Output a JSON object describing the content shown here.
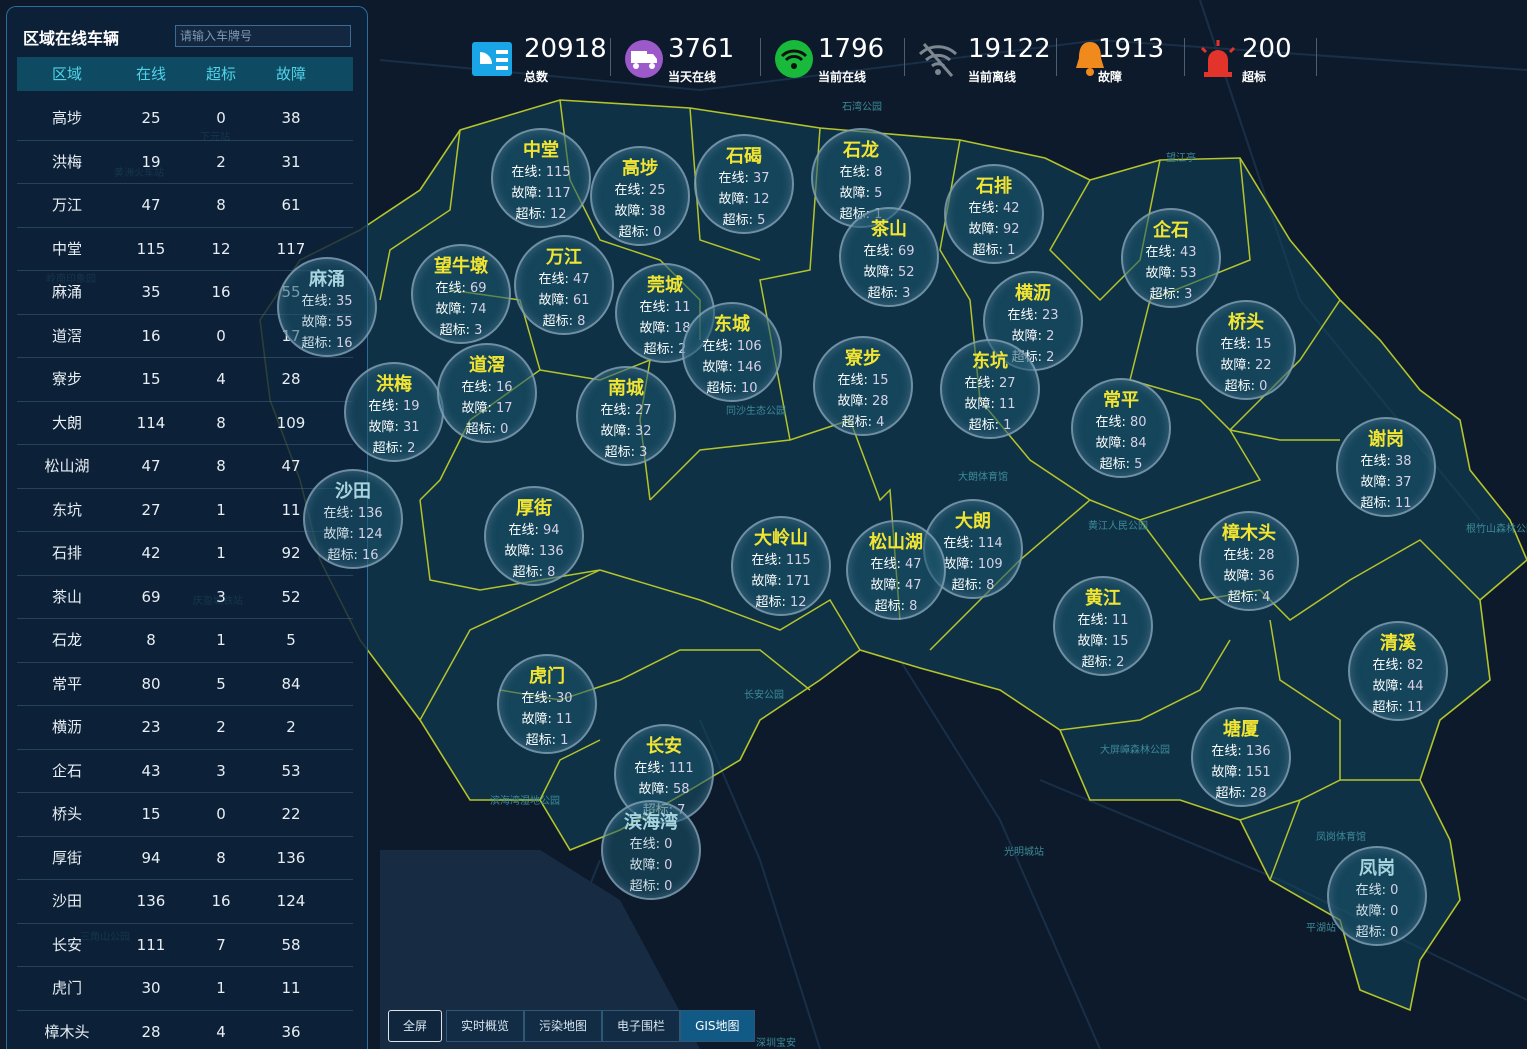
{
  "panel": {
    "title": "区域在线车辆",
    "search_placeholder": "请输入车牌号",
    "headers": [
      "区域",
      "在线",
      "超标",
      "故障"
    ],
    "rows": [
      [
        "高埗",
        "25",
        "0",
        "38"
      ],
      [
        "洪梅",
        "19",
        "2",
        "31"
      ],
      [
        "万江",
        "47",
        "8",
        "61"
      ],
      [
        "中堂",
        "115",
        "12",
        "117"
      ],
      [
        "麻涌",
        "35",
        "16",
        "55"
      ],
      [
        "道滘",
        "16",
        "0",
        "17"
      ],
      [
        "寮步",
        "15",
        "4",
        "28"
      ],
      [
        "大朗",
        "114",
        "8",
        "109"
      ],
      [
        "松山湖",
        "47",
        "8",
        "47"
      ],
      [
        "东坑",
        "27",
        "1",
        "11"
      ],
      [
        "石排",
        "42",
        "1",
        "92"
      ],
      [
        "茶山",
        "69",
        "3",
        "52"
      ],
      [
        "石龙",
        "8",
        "1",
        "5"
      ],
      [
        "常平",
        "80",
        "5",
        "84"
      ],
      [
        "横沥",
        "23",
        "2",
        "2"
      ],
      [
        "企石",
        "43",
        "3",
        "53"
      ],
      [
        "桥头",
        "15",
        "0",
        "22"
      ],
      [
        "厚街",
        "94",
        "8",
        "136"
      ],
      [
        "沙田",
        "136",
        "16",
        "124"
      ],
      [
        "长安",
        "111",
        "7",
        "58"
      ],
      [
        "虎门",
        "30",
        "1",
        "11"
      ],
      [
        "樟木头",
        "28",
        "4",
        "36"
      ]
    ]
  },
  "stats": [
    {
      "value": "20918",
      "label": "总数",
      "icon": "dashboard-icon",
      "color": "#1aa6e6"
    },
    {
      "value": "3761",
      "label": "当天在线",
      "icon": "truck-icon",
      "color": "#9b59c9"
    },
    {
      "value": "1796",
      "label": "当前在线",
      "icon": "wifi-icon",
      "color": "#19b93b"
    },
    {
      "value": "19122",
      "label": "当前离线",
      "icon": "wifi-off-icon",
      "color": "#7d8790"
    },
    {
      "value": "1913",
      "label": "故障",
      "icon": "bell-icon",
      "color": "#f08a1c"
    },
    {
      "value": "200",
      "label": "超标",
      "icon": "alarm-light-icon",
      "color": "#e2342a"
    }
  ],
  "bubble_labels": {
    "online": "在线",
    "fault": "故障",
    "over": "超标"
  },
  "regions": [
    {
      "name": "中堂",
      "online": "115",
      "fault": "117",
      "over": "12"
    },
    {
      "name": "高埗",
      "online": "25",
      "fault": "38",
      "over": "0"
    },
    {
      "name": "石碣",
      "online": "37",
      "fault": "12",
      "over": "5"
    },
    {
      "name": "石龙",
      "online": "8",
      "fault": "5",
      "over": "1"
    },
    {
      "name": "石排",
      "online": "42",
      "fault": "92",
      "over": "1"
    },
    {
      "name": "茶山",
      "online": "69",
      "fault": "52",
      "over": "3"
    },
    {
      "name": "企石",
      "online": "43",
      "fault": "53",
      "over": "3"
    },
    {
      "name": "麻涌",
      "online": "35",
      "fault": "55",
      "over": "16"
    },
    {
      "name": "望牛墩",
      "online": "69",
      "fault": "74",
      "over": "3"
    },
    {
      "name": "万江",
      "online": "47",
      "fault": "61",
      "over": "8"
    },
    {
      "name": "莞城",
      "online": "11",
      "fault": "18",
      "over": "2"
    },
    {
      "name": "横沥",
      "online": "23",
      "fault": "2",
      "over": "2"
    },
    {
      "name": "桥头",
      "online": "15",
      "fault": "22",
      "over": "0"
    },
    {
      "name": "东城",
      "online": "106",
      "fault": "146",
      "over": "10"
    },
    {
      "name": "洪梅",
      "online": "19",
      "fault": "31",
      "over": "2"
    },
    {
      "name": "道滘",
      "online": "16",
      "fault": "17",
      "over": "0"
    },
    {
      "name": "寮步",
      "online": "15",
      "fault": "28",
      "over": "4"
    },
    {
      "name": "东坑",
      "online": "27",
      "fault": "11",
      "over": "1"
    },
    {
      "name": "南城",
      "online": "27",
      "fault": "32",
      "over": "3"
    },
    {
      "name": "常平",
      "online": "80",
      "fault": "84",
      "over": "5"
    },
    {
      "name": "谢岗",
      "online": "38",
      "fault": "37",
      "over": "11"
    },
    {
      "name": "沙田",
      "online": "136",
      "fault": "124",
      "over": "16"
    },
    {
      "name": "厚街",
      "online": "94",
      "fault": "136",
      "over": "8"
    },
    {
      "name": "大岭山",
      "online": "115",
      "fault": "171",
      "over": "12"
    },
    {
      "name": "大朗",
      "online": "114",
      "fault": "109",
      "over": "8"
    },
    {
      "name": "松山湖",
      "online": "47",
      "fault": "47",
      "over": "8"
    },
    {
      "name": "樟木头",
      "online": "28",
      "fault": "36",
      "over": "4"
    },
    {
      "name": "黄江",
      "online": "11",
      "fault": "15",
      "over": "2"
    },
    {
      "name": "清溪",
      "online": "82",
      "fault": "44",
      "over": "11"
    },
    {
      "name": "虎门",
      "online": "30",
      "fault": "11",
      "over": "1"
    },
    {
      "name": "塘厦",
      "online": "136",
      "fault": "151",
      "over": "28"
    },
    {
      "name": "长安",
      "online": "111",
      "fault": "58",
      "over": "7"
    },
    {
      "name": "滨海湾",
      "online": "0",
      "fault": "0",
      "over": "0"
    },
    {
      "name": "凤岗",
      "online": "0",
      "fault": "0",
      "over": "0"
    }
  ],
  "map_labels": [
    "石湾公园",
    "望江亭",
    "下元站",
    "黄洲火车站",
    "岭南印象园",
    "庆盈城铁站",
    "同沙生态公园",
    "大朗体育馆",
    "黄江人民公园",
    "大屏嶂森林公园",
    "光明城站",
    "平湖站",
    "三角山公园",
    "根竹山森林公园",
    "深圳宝安",
    "长安公园",
    "凤岗体育馆",
    "滨海湾湿地公园"
  ],
  "tabs": [
    "全屏",
    "实时概览",
    "污染地图",
    "电子围栏",
    "GIS地图"
  ]
}
